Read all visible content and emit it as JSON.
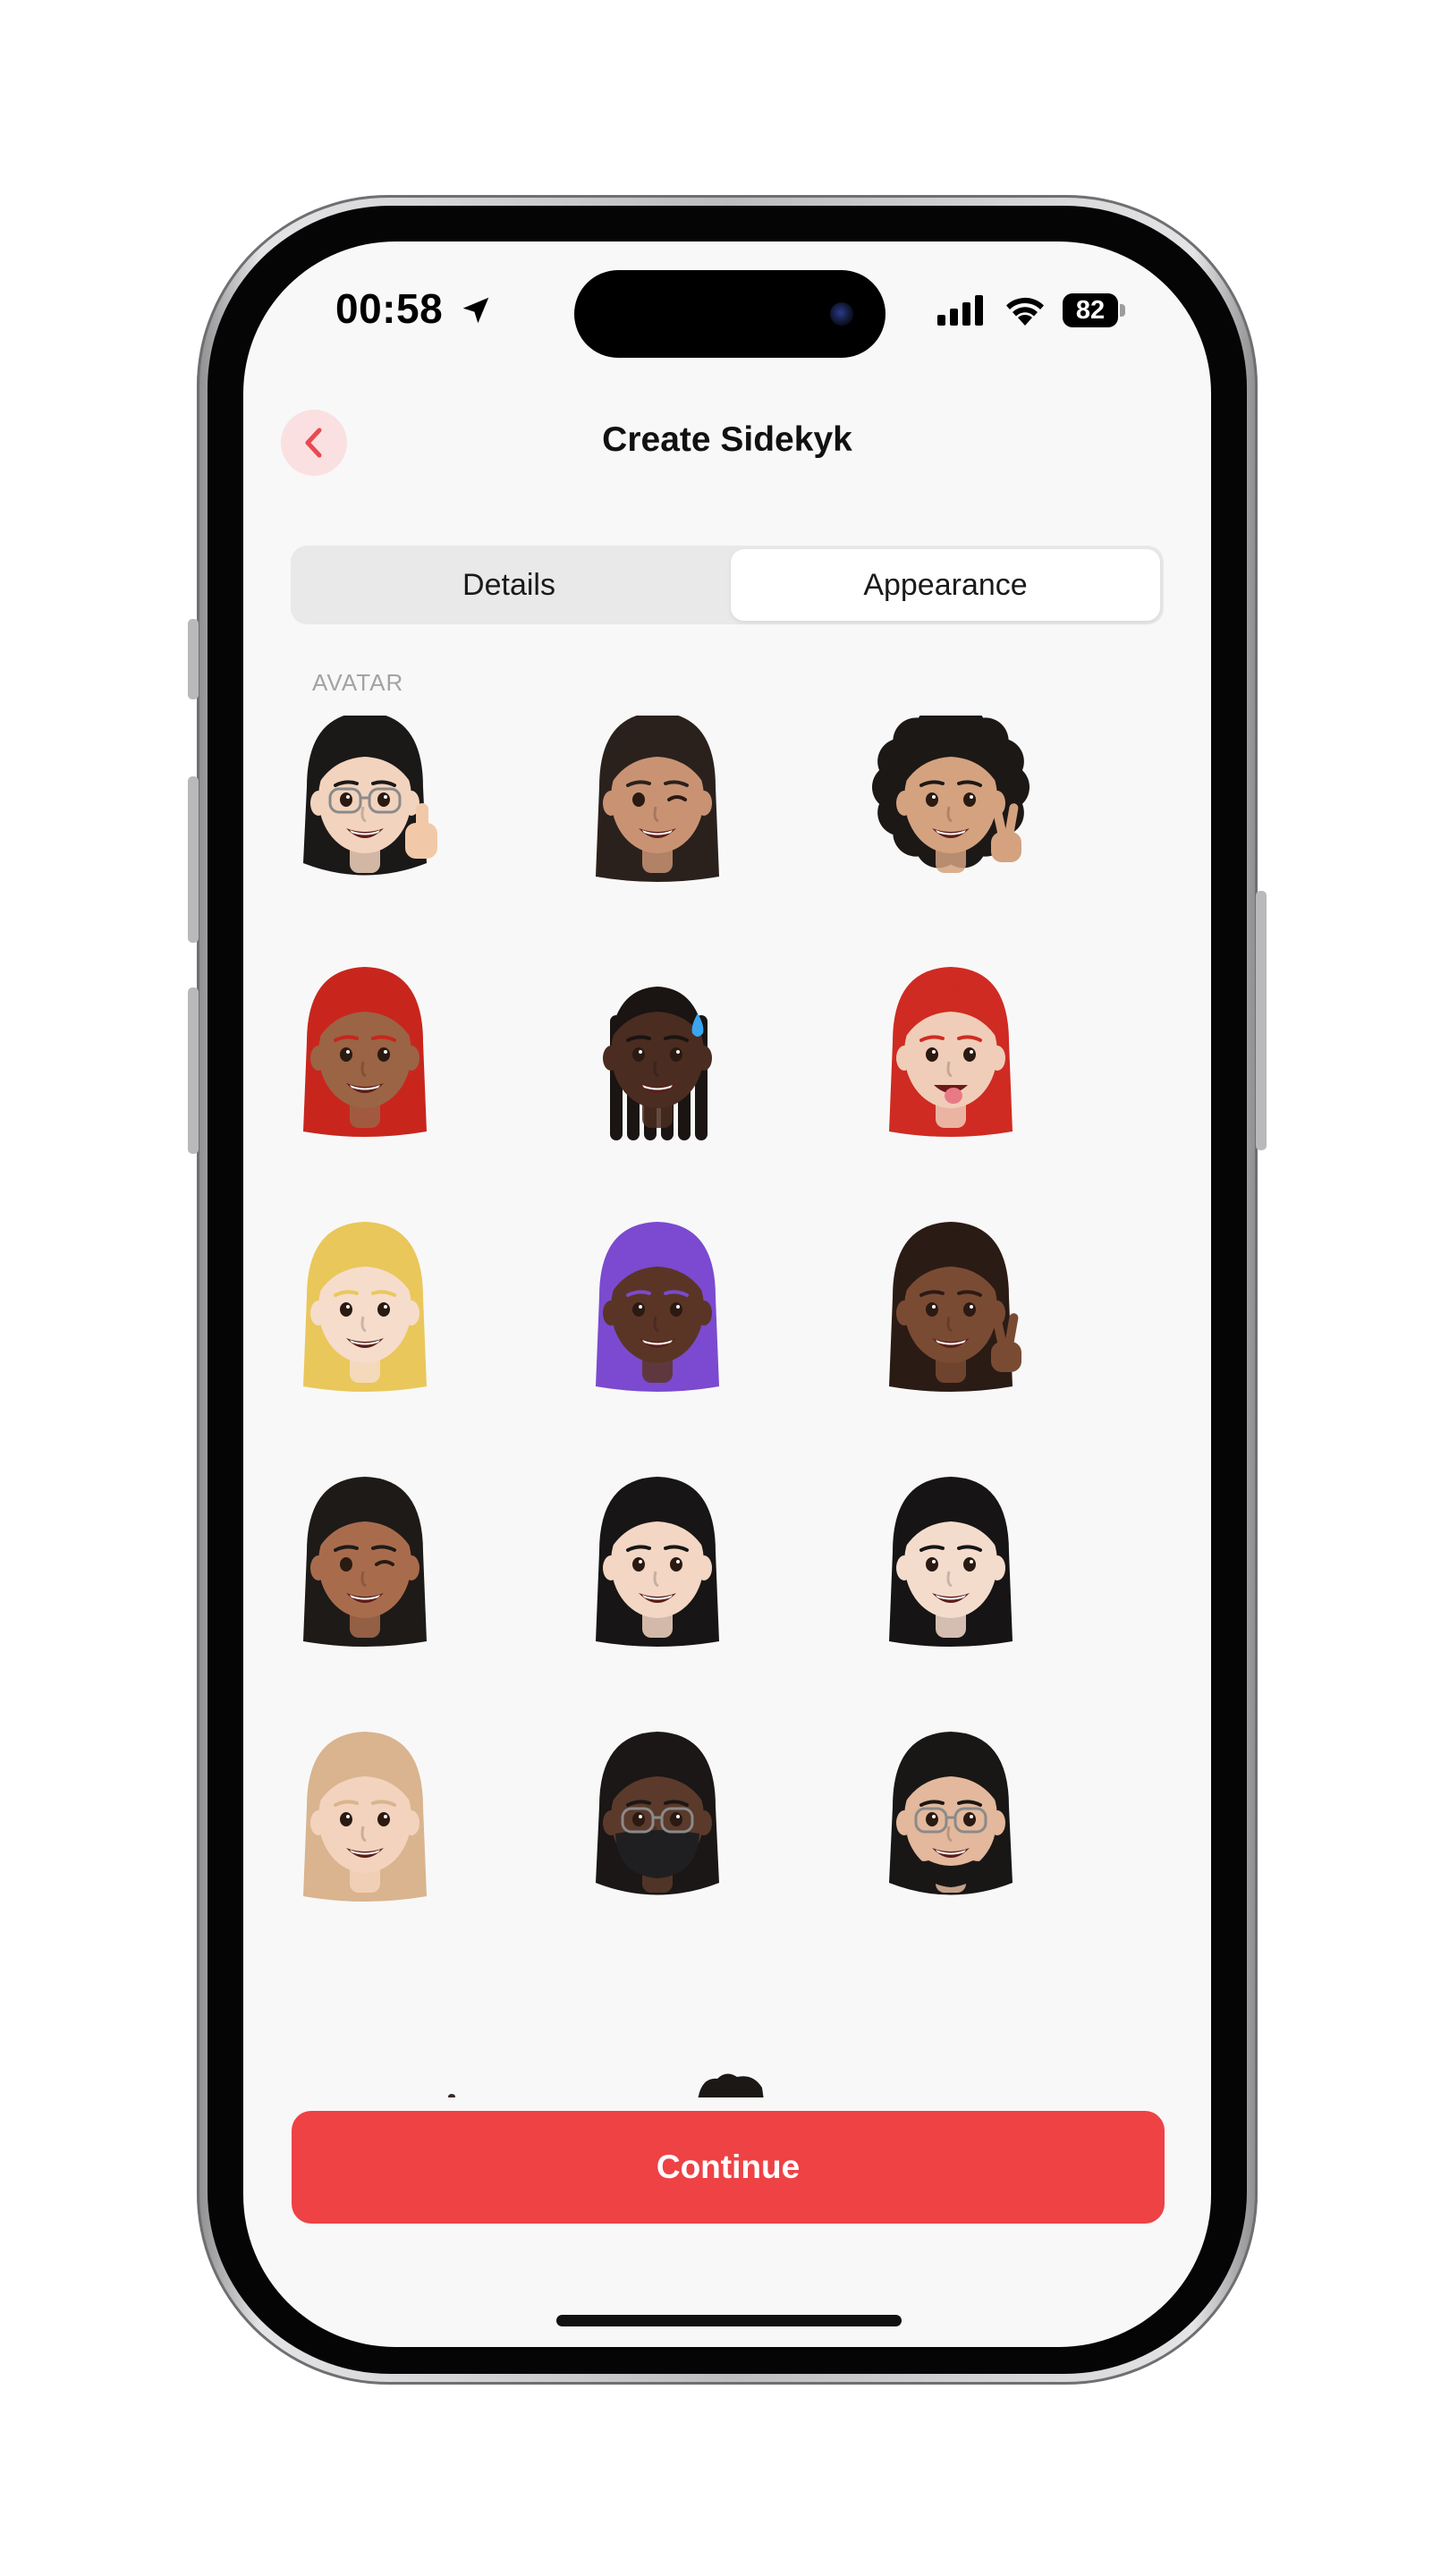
{
  "status_bar": {
    "time": "00:58",
    "battery_level": "82"
  },
  "header": {
    "title": "Create Sidekyk",
    "back_icon": "chevron-left-icon"
  },
  "tabs": [
    {
      "label": "Details",
      "selected": false
    },
    {
      "label": "Appearance",
      "selected": true
    }
  ],
  "section": {
    "label": "AVATAR"
  },
  "avatars": [
    {
      "id": "avatar-1",
      "hair": "#1b1818",
      "skin": "#f2d3bd",
      "accessory": "glasses-thumbs-up"
    },
    {
      "id": "avatar-2",
      "hair": "#2a211d",
      "skin": "#c99373",
      "accessory": "wink"
    },
    {
      "id": "avatar-3",
      "hair": "#1c1816",
      "skin": "#d4a27f",
      "accessory": "curly-peace"
    },
    {
      "id": "avatar-4",
      "hair": "#c8261d",
      "skin": "#9a6445",
      "accessory": "none"
    },
    {
      "id": "avatar-5",
      "hair": "#1a1412",
      "skin": "#4a2c20",
      "accessory": "braids-sweat"
    },
    {
      "id": "avatar-6",
      "hair": "#cf2b22",
      "skin": "#f0cdb8",
      "accessory": "tongue"
    },
    {
      "id": "avatar-7",
      "hair": "#e9c75a",
      "skin": "#f6dccb",
      "accessory": "none"
    },
    {
      "id": "avatar-8",
      "hair": "#7b4ad0",
      "skin": "#5a3526",
      "accessory": "none"
    },
    {
      "id": "avatar-9",
      "hair": "#2b1b15",
      "skin": "#7a4b33",
      "accessory": "peace"
    },
    {
      "id": "avatar-10",
      "hair": "#1e1a18",
      "skin": "#a86c4d",
      "accessory": "wink"
    },
    {
      "id": "avatar-11",
      "hair": "#171515",
      "skin": "#f3d6c3",
      "accessory": "none"
    },
    {
      "id": "avatar-12",
      "hair": "#161414",
      "skin": "#f4dccd",
      "accessory": "none"
    },
    {
      "id": "avatar-13",
      "hair": "#d9b48e",
      "skin": "#f3d3bd",
      "accessory": "none"
    },
    {
      "id": "avatar-14",
      "hair": "#1a1716",
      "skin": "#5b3a2b",
      "accessory": "mask-glasses"
    },
    {
      "id": "avatar-15",
      "hair": "#191716",
      "skin": "#e3b89c",
      "accessory": "glasses-beard"
    }
  ],
  "continue_button": {
    "label": "Continue",
    "color": "#ee4245"
  },
  "accent_color": "#e84a4f"
}
